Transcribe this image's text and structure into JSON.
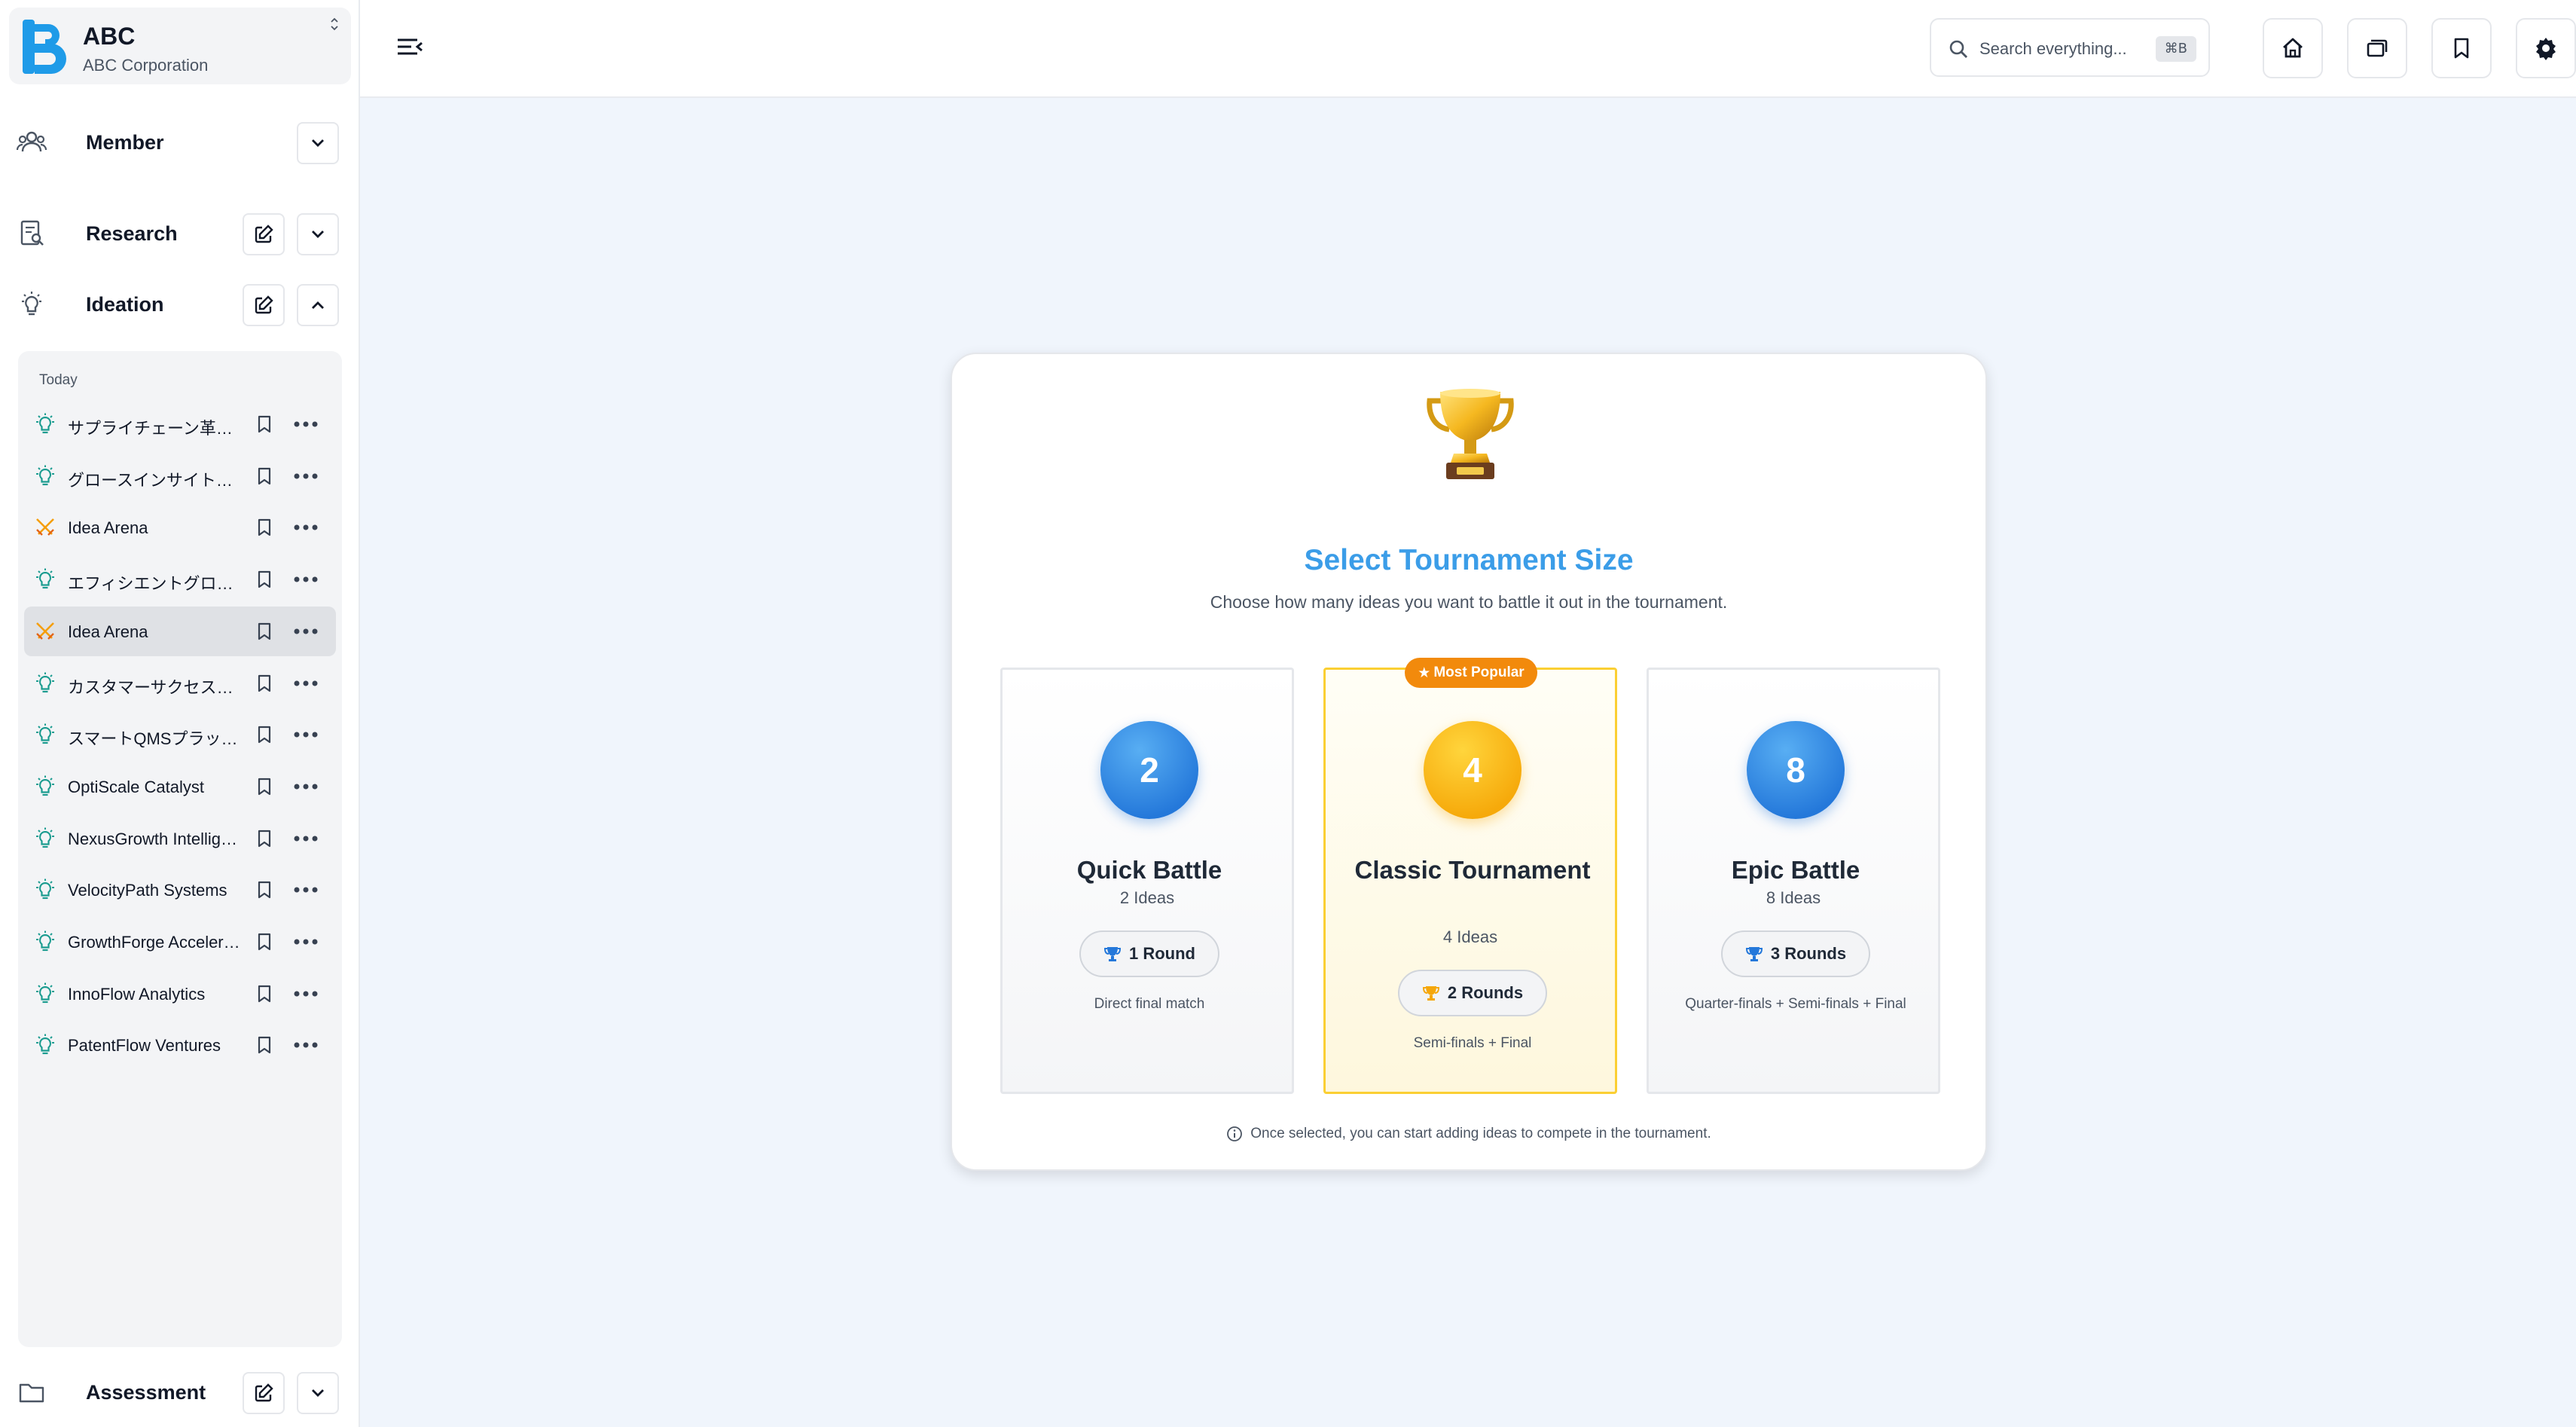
{
  "org": {
    "name": "ABC",
    "subtitle": "ABC Corporation"
  },
  "sidebar": {
    "sections": {
      "member": {
        "label": "Member",
        "icon": "users-icon"
      },
      "research": {
        "label": "Research",
        "icon": "document-search-icon"
      },
      "ideation": {
        "label": "Ideation",
        "icon": "lightbulb-icon"
      },
      "assessment": {
        "label": "Assessment",
        "icon": "folder-icon"
      }
    },
    "group_label": "Today",
    "items": [
      {
        "label": "サプライチェーン革新プラットフォーム",
        "icon": "lightbulb-icon"
      },
      {
        "label": "グロースインサイトエンジン",
        "icon": "lightbulb-icon"
      },
      {
        "label": "Idea Arena",
        "icon": "crossed-swords-icon"
      },
      {
        "label": "エフィシエントグロースシステム",
        "icon": "lightbulb-icon"
      },
      {
        "label": "Idea Arena",
        "icon": "crossed-swords-icon",
        "active": true
      },
      {
        "label": "カスタマーサクセスプラットフォーム",
        "icon": "lightbulb-icon"
      },
      {
        "label": "スマートQMSプラットフォーム",
        "icon": "lightbulb-icon"
      },
      {
        "label": "OptiScale Catalyst",
        "icon": "lightbulb-icon"
      },
      {
        "label": "NexusGrowth Intelligence",
        "icon": "lightbulb-icon"
      },
      {
        "label": "VelocityPath Systems",
        "icon": "lightbulb-icon"
      },
      {
        "label": "GrowthForge Accelerator",
        "icon": "lightbulb-icon"
      },
      {
        "label": "InnoFlow Analytics",
        "icon": "lightbulb-icon"
      },
      {
        "label": "PatentFlow Ventures",
        "icon": "lightbulb-icon"
      }
    ]
  },
  "header": {
    "search_placeholder": "Search everything...",
    "shortcut": "⌘B"
  },
  "tournament": {
    "title": "Select Tournament Size",
    "subtitle": "Choose how many ideas you want to battle it out in the tournament.",
    "popular_badge": "Most Popular",
    "options": [
      {
        "number": "2",
        "name": "Quick Battle",
        "count": "2 Ideas",
        "rounds": "1 Round",
        "desc": "Direct final match"
      },
      {
        "number": "4",
        "name": "Classic Tournament",
        "count": "4 Ideas",
        "rounds": "2 Rounds",
        "desc": "Semi-finals + Final"
      },
      {
        "number": "8",
        "name": "Epic Battle",
        "count": "8 Ideas",
        "rounds": "3 Rounds",
        "desc": "Quarter-finals + Semi-finals + Final"
      }
    ],
    "footnote": "Once selected, you can start adding ideas to compete in the tournament."
  },
  "colors": {
    "accent_blue": "#3b9de8",
    "popular_orange": "#f28a0c",
    "popular_border": "#fbcf33",
    "idea_icon_teal": "#1c9c90",
    "arena_icon_orange": "#f59e0b"
  }
}
